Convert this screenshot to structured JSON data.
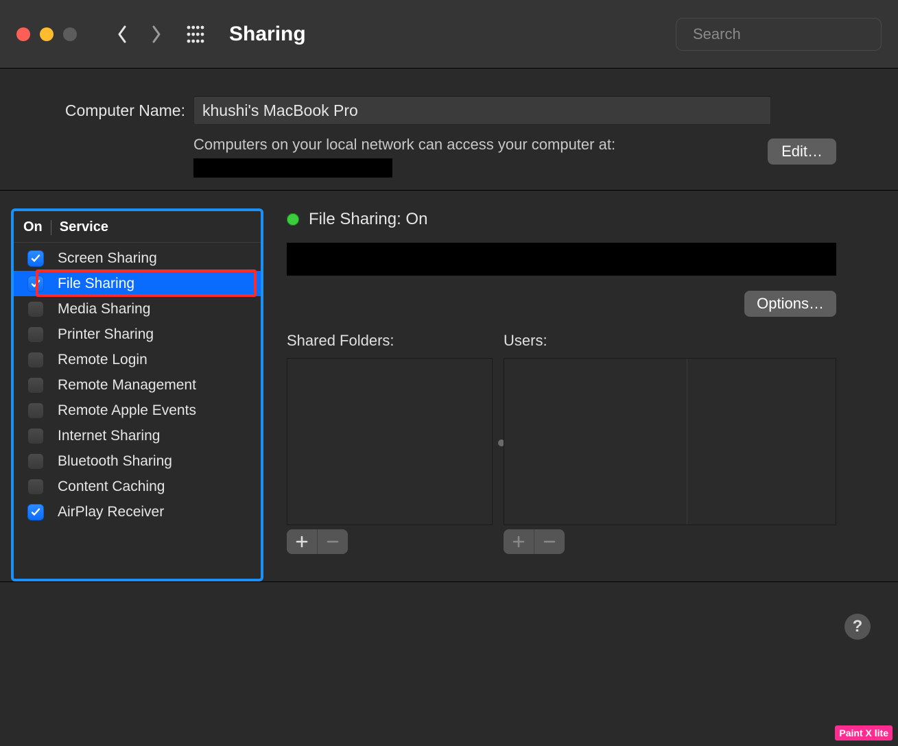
{
  "titlebar": {
    "title": "Sharing",
    "search_placeholder": "Search"
  },
  "computer_name": {
    "label": "Computer Name:",
    "value": "khushi's MacBook Pro",
    "subtext": "Computers on your local network can access your computer at:",
    "edit_label": "Edit…"
  },
  "services": {
    "header_on": "On",
    "header_service": "Service",
    "items": [
      {
        "label": "Screen Sharing",
        "checked": true,
        "selected": false
      },
      {
        "label": "File Sharing",
        "checked": true,
        "selected": true
      },
      {
        "label": "Media Sharing",
        "checked": false,
        "selected": false
      },
      {
        "label": "Printer Sharing",
        "checked": false,
        "selected": false
      },
      {
        "label": "Remote Login",
        "checked": false,
        "selected": false
      },
      {
        "label": "Remote Management",
        "checked": false,
        "selected": false
      },
      {
        "label": "Remote Apple Events",
        "checked": false,
        "selected": false
      },
      {
        "label": "Internet Sharing",
        "checked": false,
        "selected": false
      },
      {
        "label": "Bluetooth Sharing",
        "checked": false,
        "selected": false
      },
      {
        "label": "Content Caching",
        "checked": false,
        "selected": false
      },
      {
        "label": "AirPlay Receiver",
        "checked": true,
        "selected": false
      }
    ]
  },
  "detail": {
    "status_label": "File Sharing: On",
    "options_label": "Options…",
    "shared_folders_label": "Shared Folders:",
    "users_label": "Users:"
  },
  "help_label": "?",
  "watermark": "Paint X lite"
}
